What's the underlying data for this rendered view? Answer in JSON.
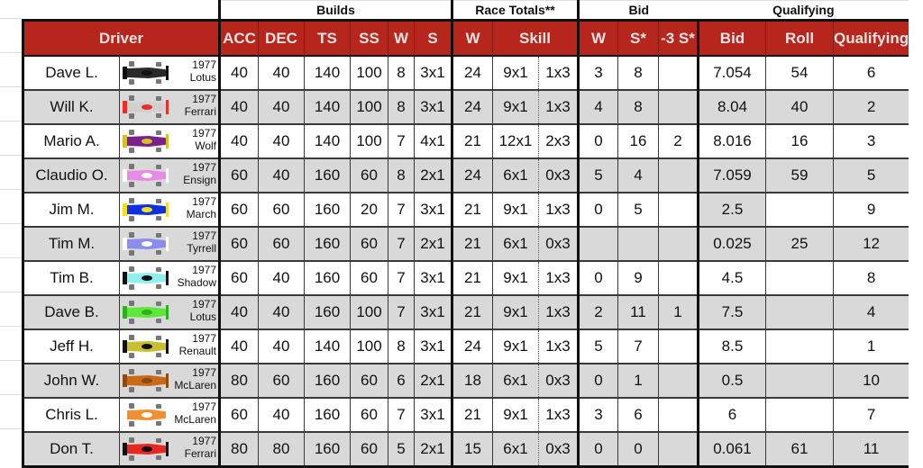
{
  "group_headers": {
    "builds": "Builds",
    "race_totals": "Race Totals**",
    "bid": "Bid",
    "qualifying": "Qualifying"
  },
  "column_headers": {
    "driver": "Driver",
    "acc": "ACC",
    "dec": "DEC",
    "ts": "TS",
    "ss": "SS",
    "w": "W",
    "s": "S",
    "rt_w": "W",
    "rt_skill": "Skill",
    "bid_w": "W",
    "bid_s": "S*",
    "bid_minus3": "-3 S*",
    "bid": "Bid",
    "roll": "Roll",
    "qualifying": "Qualifying"
  },
  "colors": {
    "header_bg": "#b7261d",
    "header_text": "#e9e3e1",
    "alt_row_bg": "#d9d9d9"
  },
  "rows": [
    {
      "driver": "Dave L.",
      "year": "1977",
      "team": "Lotus",
      "car_icon": "f1-car-icon-black",
      "car_color": "#2a2a2a",
      "car_accent": "#111111",
      "acc": "40",
      "dec": "40",
      "ts": "140",
      "ss": "100",
      "w": "8",
      "s": "3x1",
      "rt_w": "24",
      "skill_a": "9x1",
      "skill_b": "1x3",
      "bid_w": "3",
      "bid_s": "8",
      "bid_m3": "",
      "bid": "7.054",
      "roll": "54",
      "qual": "6"
    },
    {
      "driver": "Will K.",
      "year": "1977",
      "team": "Ferrari",
      "car_icon": "f1-car-icon-white-red",
      "car_color": "#d0d0d0",
      "car_accent": "#e8302a",
      "acc": "40",
      "dec": "40",
      "ts": "140",
      "ss": "100",
      "w": "8",
      "s": "3x1",
      "rt_w": "24",
      "skill_a": "9x1",
      "skill_b": "1x3",
      "bid_w": "4",
      "bid_s": "8",
      "bid_m3": "",
      "bid": "8.04",
      "roll": "40",
      "qual": "2"
    },
    {
      "driver": "Mario A.",
      "year": "1977",
      "team": "Wolf",
      "car_icon": "f1-car-icon-purple",
      "car_color": "#7a1f8c",
      "car_accent": "#d4c021",
      "acc": "40",
      "dec": "40",
      "ts": "140",
      "ss": "100",
      "w": "7",
      "s": "4x1",
      "rt_w": "21",
      "skill_a": "12x1",
      "skill_b": "2x3",
      "bid_w": "0",
      "bid_s": "16",
      "bid_m3": "2",
      "bid": "8.016",
      "roll": "16",
      "qual": "3"
    },
    {
      "driver": "Claudio O.",
      "year": "1977",
      "team": "Ensign",
      "car_icon": "f1-car-icon-pink",
      "car_color": "#e88ae6",
      "car_accent": "#ffffff",
      "acc": "60",
      "dec": "40",
      "ts": "160",
      "ss": "60",
      "w": "8",
      "s": "2x1",
      "rt_w": "24",
      "skill_a": "6x1",
      "skill_b": "0x3",
      "bid_w": "5",
      "bid_s": "4",
      "bid_m3": "",
      "bid": "7.059",
      "roll": "59",
      "qual": "5"
    },
    {
      "driver": "Jim M.",
      "year": "1977",
      "team": "March",
      "car_icon": "f1-car-icon-blue",
      "car_color": "#1030e0",
      "car_accent": "#f2e020",
      "acc": "60",
      "dec": "60",
      "ts": "160",
      "ss": "20",
      "w": "7",
      "s": "3x1",
      "rt_w": "21",
      "skill_a": "9x1",
      "skill_b": "1x3",
      "bid_w": "0",
      "bid_s": "5",
      "bid_m3": "",
      "bid": "2.5",
      "roll": "",
      "qual": "9",
      "bid_highlight": true
    },
    {
      "driver": "Tim M.",
      "year": "1977",
      "team": "Tyrrell",
      "car_icon": "f1-car-icon-lavender",
      "car_color": "#8a8cf0",
      "car_accent": "#ffffff",
      "acc": "60",
      "dec": "60",
      "ts": "160",
      "ss": "60",
      "w": "7",
      "s": "2x1",
      "rt_w": "21",
      "skill_a": "6x1",
      "skill_b": "0x3",
      "bid_w": "",
      "bid_s": "",
      "bid_m3": "",
      "bid": "0.025",
      "roll": "25",
      "qual": "12"
    },
    {
      "driver": "Tim B.",
      "year": "1977",
      "team": "Shadow",
      "car_icon": "f1-car-icon-cyan",
      "car_color": "#8ff0f0",
      "car_accent": "#111111",
      "acc": "60",
      "dec": "40",
      "ts": "160",
      "ss": "60",
      "w": "7",
      "s": "3x1",
      "rt_w": "21",
      "skill_a": "9x1",
      "skill_b": "1x3",
      "bid_w": "0",
      "bid_s": "9",
      "bid_m3": "",
      "bid": "4.5",
      "roll": "",
      "qual": "8"
    },
    {
      "driver": "Dave B.",
      "year": "1977",
      "team": "Lotus",
      "car_icon": "f1-car-icon-green",
      "car_color": "#5ee83a",
      "car_accent": "#30b020",
      "acc": "40",
      "dec": "40",
      "ts": "160",
      "ss": "100",
      "w": "7",
      "s": "3x1",
      "rt_w": "21",
      "skill_a": "9x1",
      "skill_b": "1x3",
      "bid_w": "2",
      "bid_s": "11",
      "bid_m3": "1",
      "bid": "7.5",
      "roll": "",
      "qual": "4"
    },
    {
      "driver": "Jeff H.",
      "year": "1977",
      "team": "Renault",
      "car_icon": "f1-car-icon-yellow",
      "car_color": "#c8c030",
      "car_accent": "#111111",
      "acc": "40",
      "dec": "40",
      "ts": "140",
      "ss": "100",
      "w": "8",
      "s": "3x1",
      "rt_w": "24",
      "skill_a": "9x1",
      "skill_b": "1x3",
      "bid_w": "5",
      "bid_s": "7",
      "bid_m3": "",
      "bid": "8.5",
      "roll": "",
      "qual": "1"
    },
    {
      "driver": "John W.",
      "year": "1977",
      "team": "McLaren",
      "car_icon": "f1-car-icon-brown-orange",
      "car_color": "#c86a18",
      "car_accent": "#8a4a10",
      "acc": "80",
      "dec": "60",
      "ts": "160",
      "ss": "60",
      "w": "6",
      "s": "2x1",
      "rt_w": "18",
      "skill_a": "6x1",
      "skill_b": "0x3",
      "bid_w": "0",
      "bid_s": "1",
      "bid_m3": "",
      "bid": "0.5",
      "roll": "",
      "qual": "10"
    },
    {
      "driver": "Chris L.",
      "year": "1977",
      "team": "McLaren",
      "car_icon": "f1-car-icon-orange",
      "car_color": "#f09030",
      "car_accent": "#ffffff",
      "acc": "60",
      "dec": "40",
      "ts": "160",
      "ss": "60",
      "w": "7",
      "s": "3x1",
      "rt_w": "21",
      "skill_a": "9x1",
      "skill_b": "1x3",
      "bid_w": "3",
      "bid_s": "6",
      "bid_m3": "",
      "bid": "6",
      "roll": "",
      "qual": "7"
    },
    {
      "driver": "Don T.",
      "year": "1977",
      "team": "Ferrari",
      "car_icon": "f1-car-icon-red",
      "car_color": "#e82820",
      "car_accent": "#111111",
      "acc": "80",
      "dec": "80",
      "ts": "160",
      "ss": "60",
      "w": "5",
      "s": "2x1",
      "rt_w": "15",
      "skill_a": "6x1",
      "skill_b": "0x3",
      "bid_w": "0",
      "bid_s": "0",
      "bid_m3": "",
      "bid": "0.061",
      "roll": "61",
      "qual": "11"
    }
  ]
}
